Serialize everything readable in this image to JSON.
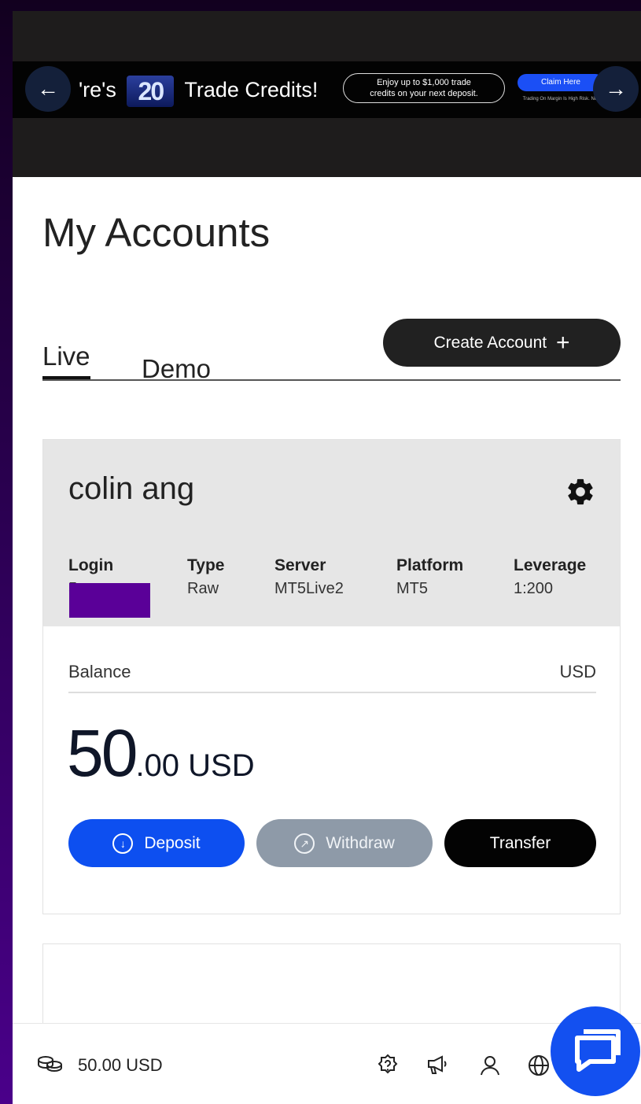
{
  "banner": {
    "headline_prefix": "'re's",
    "headline_badge": "20",
    "headline_suffix": "Trade Credits!",
    "pill_line1": "Enjoy up to $1,000 trade",
    "pill_line2": "credits on your next deposit.",
    "claim_label": "Claim Here",
    "disclaimer": "Trading On Margin Is High Risk. Not Ire... T&Cs Apply",
    "prev_arrow": "←",
    "next_arrow": "→"
  },
  "page": {
    "title": "My Accounts"
  },
  "tabs": [
    {
      "label": "Live",
      "active": true
    },
    {
      "label": "Demo",
      "active": false
    }
  ],
  "create_account": {
    "label": "Create Account",
    "icon": "+"
  },
  "account": {
    "name": "colin ang",
    "columns": [
      {
        "label": "Login",
        "value": "5"
      },
      {
        "label": "Type",
        "value": "Raw"
      },
      {
        "label": "Server",
        "value": "MT5Live2"
      },
      {
        "label": "Platform",
        "value": "MT5"
      },
      {
        "label": "Leverage",
        "value": "1:200"
      }
    ],
    "balance_label": "Balance",
    "balance_currency": "USD",
    "balance_int": "50",
    "balance_dec": ".00 USD",
    "actions": {
      "deposit": "Deposit",
      "withdraw": "Withdraw",
      "transfer": "Transfer"
    }
  },
  "bottom_bar": {
    "balance": "50.00 USD"
  },
  "colors": {
    "primary_blue": "#0d4ff0",
    "withdraw_gray": "#8e9aa8",
    "redaction_purple": "#5a0098"
  },
  "icons": [
    "arrow-left-icon",
    "arrow-right-icon",
    "gear-icon",
    "arrow-down-circle-icon",
    "arrow-up-right-circle-icon",
    "coins-icon",
    "help-badge-icon",
    "megaphone-icon",
    "user-icon",
    "globe-icon",
    "chat-icon"
  ]
}
